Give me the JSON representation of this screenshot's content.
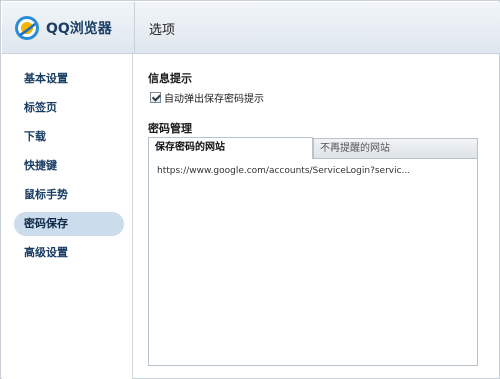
{
  "app": {
    "logo_text": "QQ浏览器",
    "page_title": "选项"
  },
  "sidebar": {
    "items": [
      {
        "label": "基本设置",
        "active": false
      },
      {
        "label": "标签页",
        "active": false
      },
      {
        "label": "下载",
        "active": false
      },
      {
        "label": "快捷键",
        "active": false
      },
      {
        "label": "鼠标手势",
        "active": false
      },
      {
        "label": "密码保存",
        "active": true
      },
      {
        "label": "高级设置",
        "active": false
      }
    ]
  },
  "info": {
    "title": "信息提示",
    "checkbox_label": "自动弹出保存密码提示",
    "checked": true
  },
  "password": {
    "title": "密码管理",
    "tabs": [
      {
        "label": "保存密码的网站",
        "active": true
      },
      {
        "label": "不再提醒的网站",
        "active": false
      }
    ],
    "saved_sites": [
      "https://www.google.com/accounts/ServiceLogin?servic..."
    ]
  },
  "colors": {
    "nav_text": "#1a3d63",
    "nav_active_bg": "#cbdcec",
    "header_bg": "#e6edf3"
  }
}
